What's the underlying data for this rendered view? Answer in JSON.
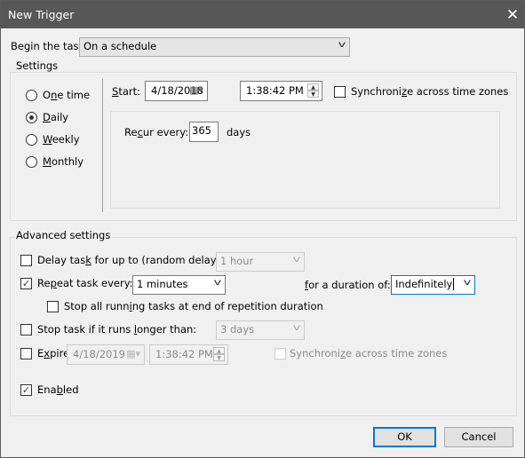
{
  "window": {
    "title": "New Trigger",
    "close_icon": "close-icon"
  },
  "begin": {
    "label": "Begin the task:",
    "key": "g",
    "value": "On a schedule"
  },
  "settings": {
    "legend": "Settings",
    "radios": [
      {
        "label": "One time",
        "key": "n",
        "selected": false
      },
      {
        "label": "Daily",
        "key": "D",
        "selected": true
      },
      {
        "label": "Weekly",
        "key": "W",
        "selected": false
      },
      {
        "label": "Monthly",
        "key": "M",
        "selected": false
      }
    ],
    "start_label": "Start:",
    "start_key": "S",
    "start_date": "4/18/2018",
    "start_time": "1:38:42 PM",
    "sync_label": "Synchronize across time zones",
    "sync_key": "z",
    "sync_checked": false,
    "recur_label": "Recur every:",
    "recur_key": "c",
    "recur_value": "365",
    "recur_unit": "days"
  },
  "advanced": {
    "legend": "Advanced settings",
    "delay": {
      "label": "Delay task for up to (random delay):",
      "key": "k",
      "checked": false,
      "value": "1 hour"
    },
    "repeat": {
      "label": "Repeat task every:",
      "key": "p",
      "checked": true,
      "value": "1 minutes",
      "duration_label": "for a duration of:",
      "duration_key": "f",
      "duration_value": "Indefinitely"
    },
    "stop_all": {
      "label": "Stop all running tasks at end of repetition duration",
      "key": "i",
      "checked": false
    },
    "stop_task": {
      "label": "Stop task if it runs longer than:",
      "key": "l",
      "checked": false,
      "value": "3 days"
    },
    "expire": {
      "label": "Expire:",
      "key": "x",
      "checked": false,
      "date": "4/18/2019",
      "time": "1:38:42 PM",
      "sync_label": "Synchronize across time zones",
      "sync_key": "z"
    },
    "enabled": {
      "label": "Enabled",
      "key": "b",
      "checked": true
    }
  },
  "buttons": {
    "ok": "OK",
    "cancel": "Cancel"
  },
  "colors": {
    "titlebar": "#575757",
    "focus": "#0078d7",
    "background": "#f0f0f0"
  }
}
